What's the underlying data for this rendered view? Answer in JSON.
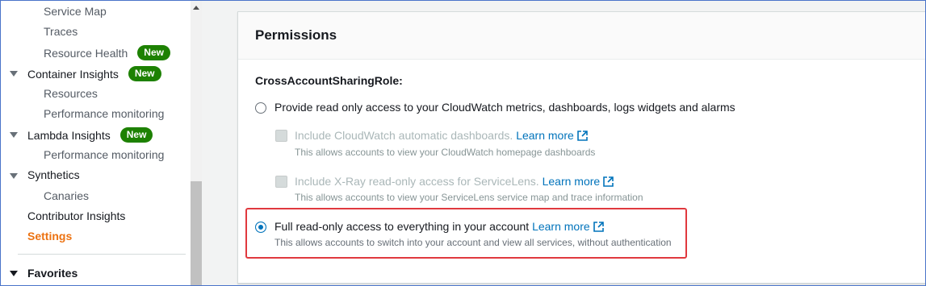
{
  "sidebar": {
    "items": [
      {
        "label": "Service Map"
      },
      {
        "label": "Traces"
      },
      {
        "label": "Resource Health",
        "badge": "New"
      },
      {
        "label": "Container Insights",
        "badge": "New"
      },
      {
        "label": "Resources"
      },
      {
        "label": "Performance monitoring"
      },
      {
        "label": "Lambda Insights",
        "badge": "New"
      },
      {
        "label": "Performance monitoring"
      },
      {
        "label": "Synthetics"
      },
      {
        "label": "Canaries"
      },
      {
        "label": "Contributor Insights"
      },
      {
        "label": "Settings"
      }
    ],
    "favorites_label": "Favorites",
    "active_color": "#ec7211",
    "badge_color": "#1d8102"
  },
  "panel": {
    "title": "Permissions",
    "role_label": "CrossAccountSharingRole:",
    "options": [
      {
        "label": "Provide read only access to your CloudWatch metrics, dashboards, logs widgets and alarms",
        "selected": false
      },
      {
        "label": "Full read-only access to everything in your account",
        "link": "Learn more",
        "description": "This allows accounts to switch into your account and view all services, without authentication",
        "selected": true
      }
    ],
    "sub_options": [
      {
        "label": "Include CloudWatch automatic dashboards.",
        "link": "Learn more",
        "description": "This allows accounts to view your CloudWatch homepage dashboards",
        "disabled": true
      },
      {
        "label": "Include X-Ray read-only access for ServiceLens.",
        "link": "Learn more",
        "description": "This allows accounts to view your ServiceLens service map and trace information",
        "disabled": true
      }
    ]
  },
  "colors": {
    "link": "#0073bb",
    "highlight": "#e0393e"
  }
}
